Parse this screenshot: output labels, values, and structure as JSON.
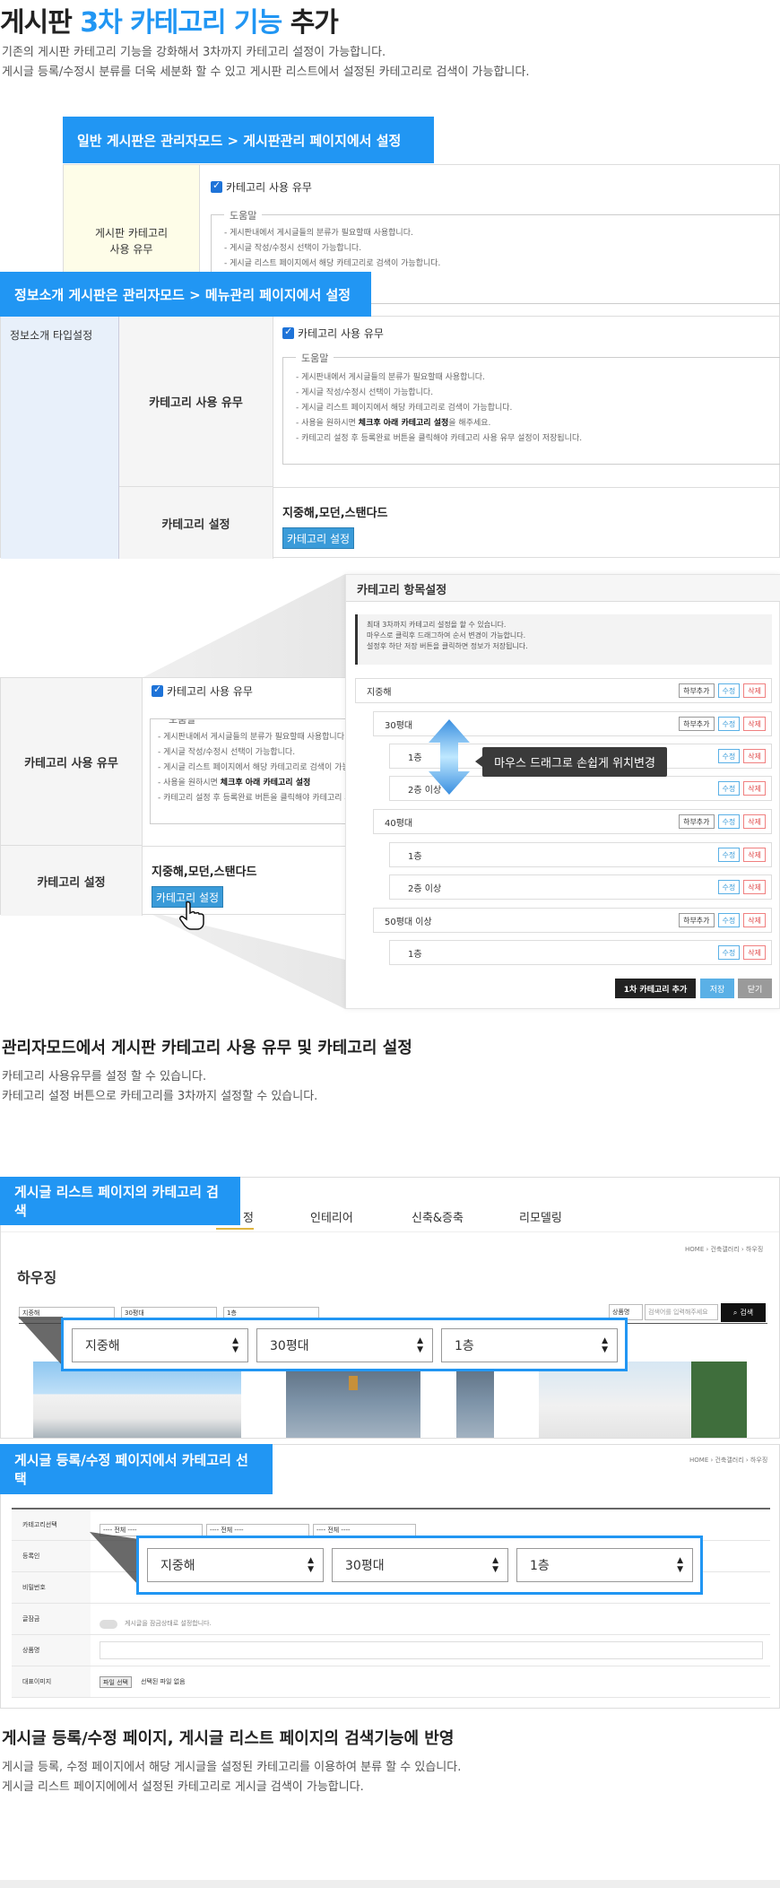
{
  "header": {
    "title_pre": "게시판",
    "title_accent": "3차 카테고리 기능",
    "title_post": "추가",
    "desc_line1": "기존의 게시판 카테고리 기능을 강화해서 3차까지 카테고리 설정이 가능합니다.",
    "desc_line2": "게시글 등록/수정시 분류를 더욱 세분화 할 수 있고 게시판 리스트에서 설정된 카테고리로 검색이 가능합니다."
  },
  "section1": {
    "tag_general": "일반 게시판은 관리자모드 > 게시판관리 페이지에서 설정",
    "tag_info": "정보소개 게시판은 관리자모드 > 메뉴관리 페이지에서 설정",
    "board_category_label_1": "게시판 카테고리",
    "board_category_label_2": "사용 유무",
    "category_use_checkbox": "카테고리 사용 유무",
    "help_legend": "도움말",
    "help_lines": [
      "- 게시판내에서 게시글들의 분류가 필요할때 사용합니다.",
      "- 게시글 작성/수정시 선택이 가능합니다.",
      "- 게시글 리스트 페이지에서 해당 카테고리로 검색이 가능합니다.",
      "- 사용을 원하시면 ",
      "- 카테고리 설정 후 등록완료 버튼을 클릭해야 카테고리 사용 유무 설정이 저장됩니다."
    ],
    "help_bold": "체크후 아래 카테고리 설정",
    "help_tail": "을 해주세요.",
    "info_type_label": "정보소개 타입설정",
    "category_use_label": "카테고리 사용 유무",
    "category_setting_label": "카테고리 설정",
    "category_values": "지중해,모던,스탠다드",
    "category_setting_button": "카테고리 설정"
  },
  "modal": {
    "title": "카테고리 항목설정",
    "notice": [
      "최대 3차까지 카테고리 설정을 할 수 있습니다.",
      "마우스로 클릭후 드래그하여 순서 변경이 가능합니다.",
      "설정후 하단 저장 버튼을 클릭하면 정보가 저장됩니다."
    ],
    "btn_add_child": "하부추가",
    "btn_edit": "수정",
    "btn_delete": "삭제",
    "rows": [
      {
        "label": "지중해",
        "level": 1,
        "child": true
      },
      {
        "label": "30평대",
        "level": 2,
        "child": true
      },
      {
        "label": "1층",
        "level": 3,
        "child": false
      },
      {
        "label": "2층 이상",
        "level": 3,
        "child": false
      },
      {
        "label": "40평대",
        "level": 2,
        "child": true
      },
      {
        "label": "1층",
        "level": 3,
        "child": false
      },
      {
        "label": "2층 이상",
        "level": 3,
        "child": false
      },
      {
        "label": "50평대 이상",
        "level": 2,
        "child": true
      },
      {
        "label": "1층",
        "level": 3,
        "child": false
      }
    ],
    "drag_tooltip": "마우스 드래그로 손쉽게 위치변경",
    "btn_add_first": "1차 카테고리 추가",
    "btn_save": "저장",
    "btn_close": "닫기"
  },
  "section2": {
    "title": "관리자모드에서 게시판 카테고리 사용 유무 및 카테고리 설정",
    "desc_line1": "카테고리 사용유무를 설정 할 수 있습니다.",
    "desc_line2": "카테고리 설정 버튼으로 카테고리를 3차까지 설정할 수 있습니다."
  },
  "section3": {
    "tag_list": "게시글 리스트 페이지의 카테고리 검색",
    "tabs": [
      "건축설정",
      "인테리어",
      "신축&증축",
      "리모델링"
    ],
    "tab_partial": "정",
    "breadcrumb": "HOME › 건축갤러리 › 하우징",
    "page_title": "하우징",
    "mini_selects": [
      "지중해",
      "30평대",
      "1층"
    ],
    "search_select": "상품명",
    "search_placeholder": "검색어를 입력해주세요",
    "search_button": "검색",
    "big_selects": [
      "지중해",
      "30평대",
      "1층"
    ]
  },
  "section4": {
    "tag_write": "게시글 등록/수정 페이지에서 카테고리 선택",
    "breadcrumb": "HOME › 건축갤러리 › 하우징",
    "rows": [
      "카테고리선택",
      "등록인",
      "비밀번호",
      "글잠금",
      "상품명",
      "대표이미지"
    ],
    "mini_selects": [
      "---- 전체 ----",
      "---- 전체 ----",
      "---- 전체 ----"
    ],
    "lock_text": "게시글을 잠금상태로 설정합니다.",
    "file_button": "파일 선택",
    "file_text": "선택된 파일 없음",
    "big_selects": [
      "지중해",
      "30평대",
      "1층"
    ]
  },
  "section5": {
    "title": "게시글 등록/수정 페이지, 게시글 리스트 페이지의 검색기능에 반영",
    "desc_line1": "게시글 등록, 수정 페이지에서 해당 게시글을 설정된 카테고리를 이용하여 분류 할 수 있습니다.",
    "desc_line2": "게시글 리스트 페이지에에서 설정된 카테고리로 게시글 검색이 가능합니다."
  },
  "colors": {
    "accent": "#2196f3",
    "button_blue": "#3a9bd9",
    "dark": "#333333"
  }
}
